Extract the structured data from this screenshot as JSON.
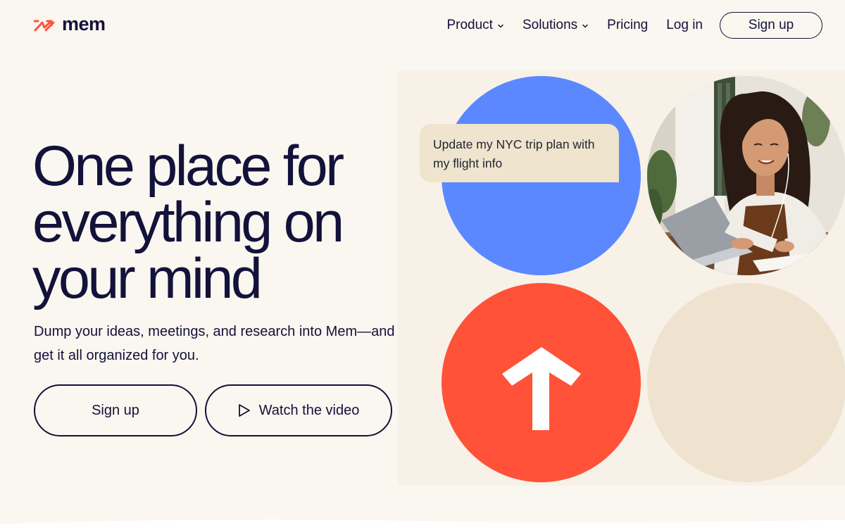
{
  "brand": {
    "name": "mem",
    "accent": "#ff5238",
    "text_color": "#12123a"
  },
  "nav": {
    "product_label": "Product",
    "solutions_label": "Solutions",
    "pricing_label": "Pricing",
    "login_label": "Log in",
    "signup_label": "Sign up"
  },
  "hero": {
    "headline": "One place for everything on your mind",
    "subtext": "Dump your ideas, meetings, and research into Mem—and get it all organized for you.",
    "signup_button": "Sign up",
    "video_button": "Watch the video"
  },
  "visual": {
    "bubble_text": "Update my NYC trip plan with my flight info",
    "colors": {
      "blue": "#5b88fe",
      "red": "#ff5238",
      "beige": "#efe3cf",
      "bubble": "#efe4cd"
    }
  },
  "icons": {
    "logo": "mem-logo-arrows-icon",
    "chevron": "chevron-down-icon",
    "play": "play-icon",
    "arrow": "arrow-up-icon"
  }
}
